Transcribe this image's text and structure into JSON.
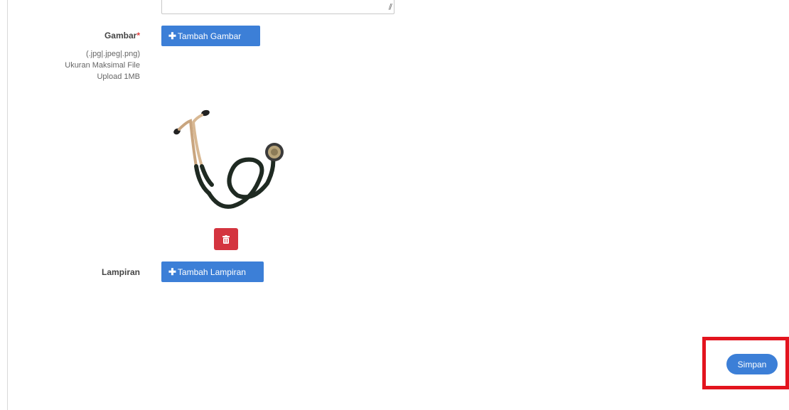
{
  "form": {
    "gambar": {
      "label": "Gambar",
      "required_marker": "*",
      "hint_lines": [
        ".jpg|.jpeg|.png)",
        "Ukuran Maksimal File",
        "Upload 1MB"
      ],
      "hint_prefix": "(",
      "add_button_icon": "plus-icon",
      "add_button_label": "Tambah Gambar",
      "preview_image": "stethoscope",
      "delete_button_icon": "trash-icon"
    },
    "lampiran": {
      "label": "Lampiran",
      "add_button_icon": "plus-icon",
      "add_button_label": "Tambah Lampiran"
    },
    "submit": {
      "label": "Simpan"
    }
  },
  "colors": {
    "primary": "#3c7fd7",
    "danger": "#d4343f",
    "required": "#e03b3b",
    "highlight": "#e3141e"
  }
}
